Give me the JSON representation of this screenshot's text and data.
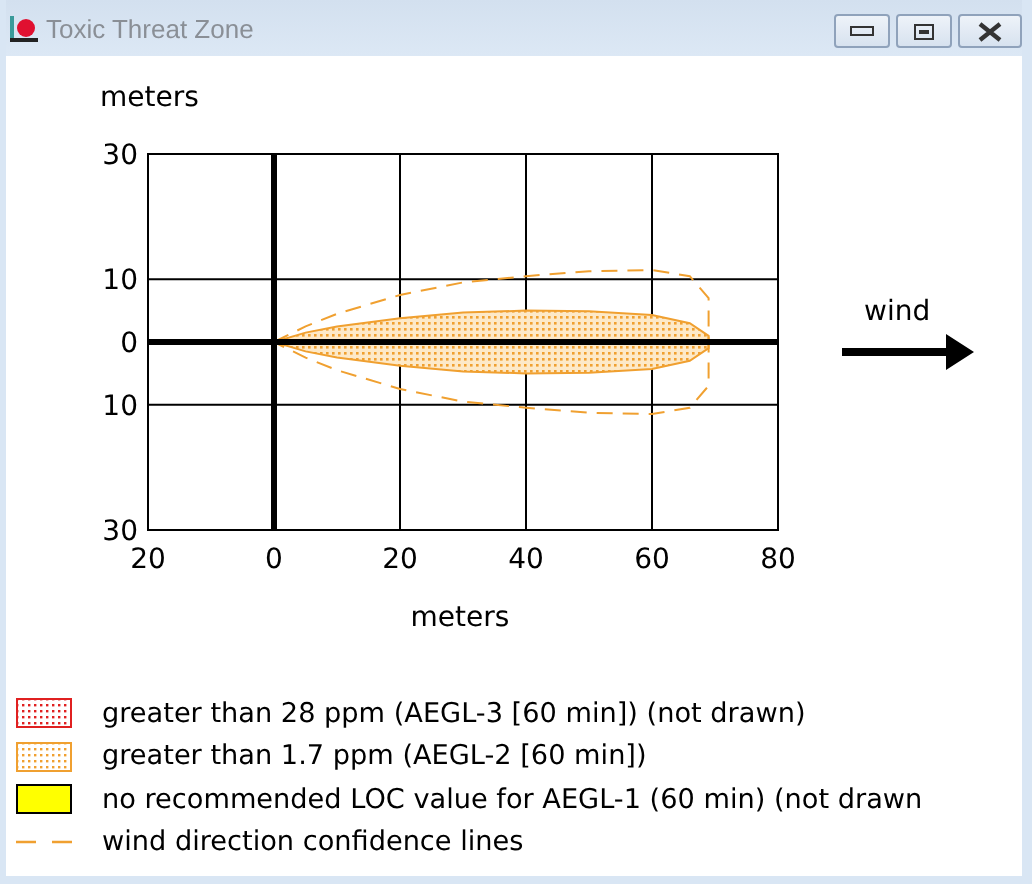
{
  "window": {
    "title": "Toxic Threat Zone"
  },
  "chart": {
    "chart_data": {
      "type": "area",
      "ylabel": "meters",
      "xlabel": "meters",
      "xlim": [
        -20,
        80
      ],
      "ylim": [
        -30,
        30
      ],
      "xticks": [
        {
          "value": -20,
          "label": "20"
        },
        0,
        20,
        40,
        60,
        80
      ],
      "yticks": [
        {
          "value": 30,
          "label": "30"
        },
        10,
        0,
        {
          "value": -10,
          "label": "10"
        },
        {
          "value": -30,
          "label": "30"
        }
      ],
      "grid": true
    }
  },
  "wind": {
    "label": "wind"
  },
  "legend": [
    {
      "kind": "dotted",
      "color": "#e02020",
      "label": "greater than 28 ppm (AEGL-3 [60 min]) (not drawn)"
    },
    {
      "kind": "dotted",
      "color": "#f0a030",
      "label": "greater than 1.7 ppm (AEGL-2 [60 min])"
    },
    {
      "kind": "solid",
      "color": "#ffff00",
      "label": "no recommended LOC value for AEGL-1 (60 min) (not drawn"
    },
    {
      "kind": "dashed",
      "color": "#f0a030",
      "label": "wind direction confidence lines"
    }
  ]
}
